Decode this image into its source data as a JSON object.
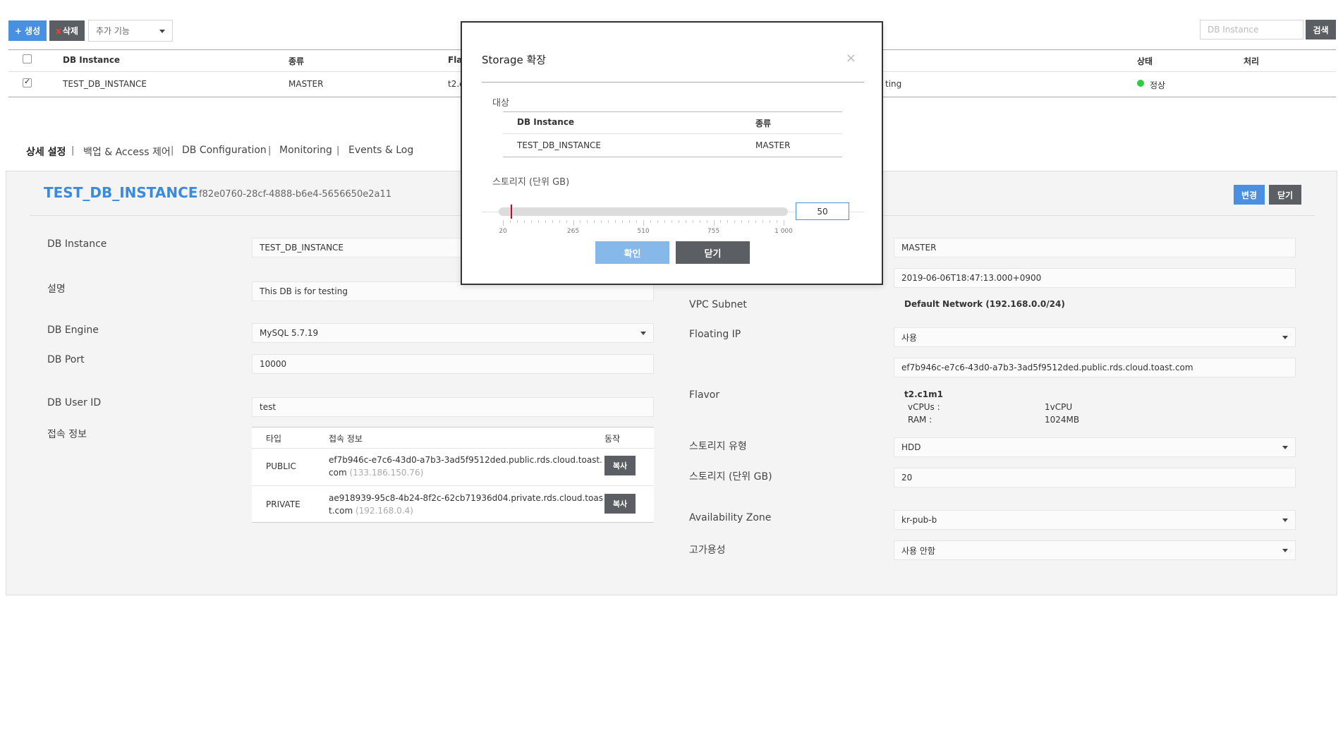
{
  "toolbar": {
    "create_label": "+ 생성",
    "delete_x": "x",
    "delete_label": "삭제",
    "more_features": "추가 기능",
    "search_placeholder": "DB Instance",
    "search_button": "검색"
  },
  "instance_table": {
    "headers": {
      "db_instance": "DB Instance",
      "type": "종류",
      "flavor": "Fla",
      "status": "상태",
      "process": "처리"
    },
    "row": {
      "name": "TEST_DB_INSTANCE",
      "type": "MASTER",
      "flavor_partial": "t2.c",
      "desc_partial": "ting",
      "status": "정상"
    }
  },
  "tabs": [
    {
      "label": "상세 설정"
    },
    {
      "label": "백업 & Access 제어"
    },
    {
      "label": "DB Configuration"
    },
    {
      "label": "Monitoring"
    },
    {
      "label": "Events & Log"
    }
  ],
  "tab_separator": "|",
  "detail": {
    "title": "TEST_DB_INSTANCE",
    "uuid": "f82e0760-28cf-4888-b6e4-5656650e2a11",
    "change_button": "변경",
    "close_button": "닫기",
    "left": {
      "db_instance_label": "DB Instance",
      "db_instance_value": "TEST_DB_INSTANCE",
      "description_label": "설명",
      "description_value": "This DB is for testing",
      "engine_label": "DB Engine",
      "engine_value": "MySQL 5.7.19",
      "port_label": "DB Port",
      "port_value": "10000",
      "user_label": "DB User ID",
      "user_value": "test",
      "conn_label": "접속 정보"
    },
    "conn_table": {
      "headers": {
        "type": "타입",
        "info": "접속 정보",
        "action": "동작"
      },
      "rows": [
        {
          "type": "PUBLIC",
          "line1": "ef7b946c-e7c6-43d0-a7b3-3ad5f9512ded.public.rds.cloud.toast.",
          "line2": "com",
          "ip": "(133.186.150.76)",
          "action": "복사"
        },
        {
          "type": "PRIVATE",
          "line1": "ae918939-95c8-4b24-8f2c-62cb71936d04.private.rds.cloud.toas",
          "line2": "t.com",
          "ip": "(192.168.0.4)",
          "action": "복사"
        }
      ]
    },
    "right": {
      "type_value": "MASTER",
      "created_value": "2019-06-06T18:47:13.000+0900",
      "vpc_label": "VPC Subnet",
      "vpc_value": "Default Network (192.168.0.0/24)",
      "floating_label": "Floating IP",
      "floating_value": "사용",
      "floating_domain": "ef7b946c-e7c6-43d0-a7b3-3ad5f9512ded.public.rds.cloud.toast.com",
      "flavor_label": "Flavor",
      "flavor_name": "t2.c1m1",
      "vcpu_label": "vCPUs :",
      "vcpu_value": "1vCPU",
      "ram_label": "RAM :",
      "ram_value": "1024MB",
      "storage_type_label": "스토리지 유형",
      "storage_type_value": "HDD",
      "storage_size_label": "스토리지 (단위 GB)",
      "storage_size_value": "20",
      "az_label": "Availability Zone",
      "az_value": "kr-pub-b",
      "ha_label": "고가용성",
      "ha_value": "사용 안함"
    }
  },
  "modal": {
    "title": "Storage 확장",
    "close_icon": "×",
    "target_label": "대상",
    "table_headers": {
      "db_instance": "DB Instance",
      "type": "종류"
    },
    "table_row": {
      "db_instance": "TEST_DB_INSTANCE",
      "type": "MASTER"
    },
    "storage_label": "스토리지 (단위 GB)",
    "slider_min": 20,
    "slider_max": 1000,
    "slider_value": 50,
    "tick_labels": [
      "20",
      "265",
      "510",
      "755",
      "1 000"
    ],
    "storage_value": "50",
    "confirm_button": "확인",
    "close_button": "닫기"
  },
  "colors": {
    "accent_blue": "#4a90e2",
    "title_blue": "#3a8be0",
    "dark_button": "#5b5e62",
    "status_green": "#2ecc40",
    "slider_handle": "#d0021b"
  }
}
